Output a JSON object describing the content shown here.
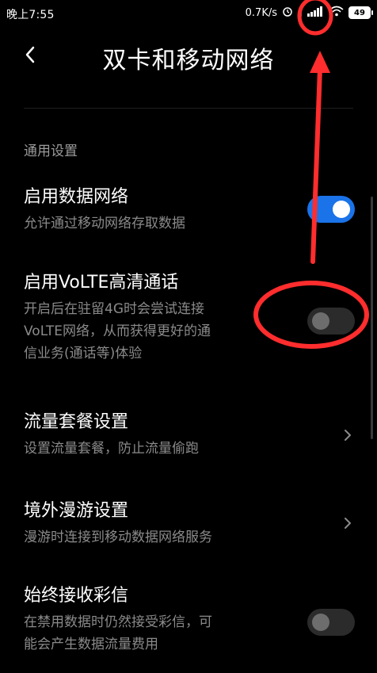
{
  "status_bar": {
    "time": "晚上7:55",
    "net_speed": "0.7K/s",
    "battery": "49"
  },
  "header": {
    "title": "双卡和移动网络"
  },
  "section": {
    "title": "通用设置"
  },
  "items": [
    {
      "title": "启用数据网络",
      "subtitle_lines": [
        "允许通过移动网络存取数据"
      ],
      "control": "toggle",
      "enabled": true
    },
    {
      "title": "启用VoLTE高清通话",
      "subtitle_lines": [
        "开启后在驻留4G时会尝试连接",
        "VoLTE网络，从而获得更好的通",
        "信业务(通话等)体验"
      ],
      "control": "toggle",
      "enabled": false
    },
    {
      "title": "流量套餐设置",
      "subtitle_lines": [
        "设置流量套餐，防止流量偷跑"
      ],
      "control": "chevron"
    },
    {
      "title": "境外漫游设置",
      "subtitle_lines": [
        "漫游时连接到移动数据网络服务"
      ],
      "control": "chevron"
    },
    {
      "title": "始终接收彩信",
      "subtitle_lines": [
        "在禁用数据时仍然接受彩信，可",
        "能会产生数据流量费用"
      ],
      "control": "toggle",
      "enabled": false
    }
  ],
  "colors": {
    "accent": "#1a73e8",
    "annotation": "#ff2d2d"
  }
}
